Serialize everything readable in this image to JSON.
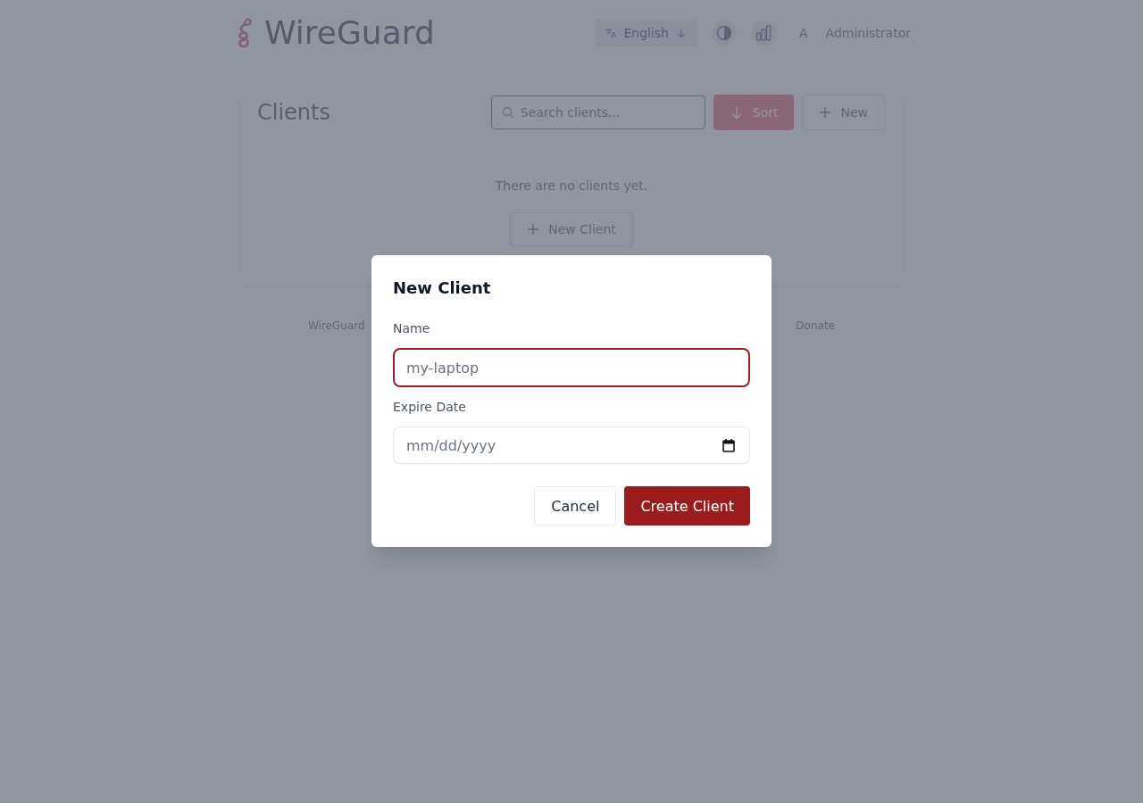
{
  "header": {
    "title": "WireGuard",
    "language": "English",
    "user_initial": "A",
    "user_name": "Administrator"
  },
  "clients_card": {
    "title": "Clients",
    "search": {
      "placeholder": "Search clients..."
    },
    "sort_button": "Sort",
    "new_button": "New",
    "empty_text": "There are no clients yet.",
    "new_client_button": "New Client"
  },
  "footer": {
    "left_text": "WireGuard",
    "right_text": "Donate"
  },
  "dialog": {
    "title": "New Client",
    "fields": [
      {
        "kind": "text",
        "label": "Name",
        "placeholder": "my-laptop",
        "focused": true
      },
      {
        "kind": "date",
        "label": "Expire Date",
        "placeholder": "mm/dd/yyyy",
        "focused": false
      }
    ],
    "buttons": [
      {
        "kind": "secondary",
        "label": "Cancel"
      },
      {
        "kind": "primary",
        "label": "Create Client"
      }
    ]
  }
}
